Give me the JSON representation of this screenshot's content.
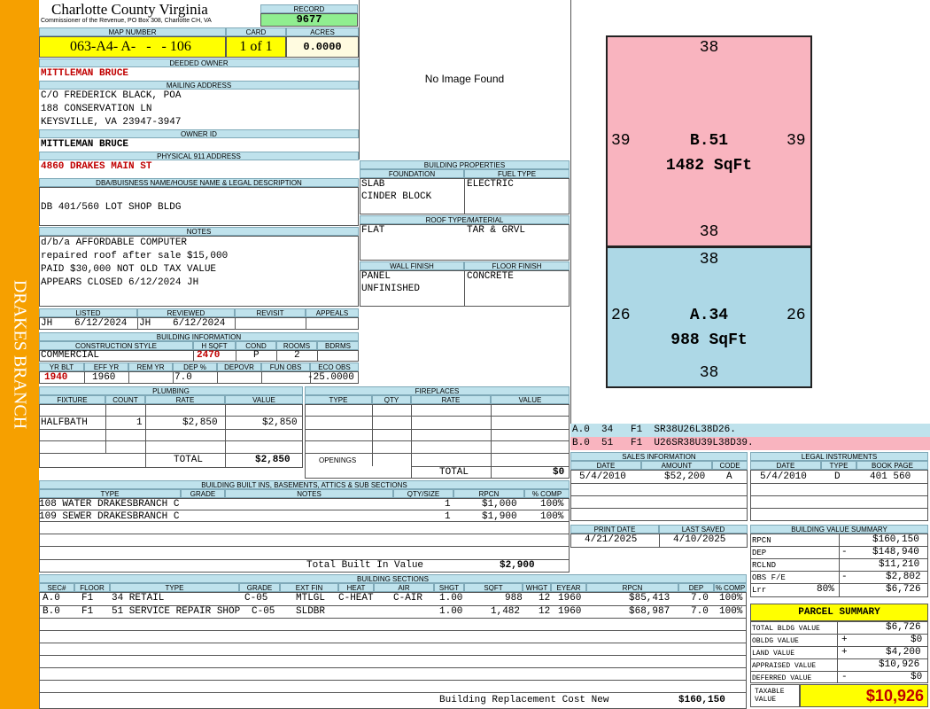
{
  "county_title": "Charlotte County Virginia",
  "county_sub": "Commissioner of the Revenue, PO Box 308, Charlotte CH, VA",
  "side_label": "DRAKES BRANCH",
  "record": {
    "label": "RECORD",
    "value": "9677"
  },
  "map": {
    "label": "MAP NUMBER",
    "value": "063-A4- A-   -   - 106"
  },
  "card": {
    "label": "CARD",
    "value": "1 of 1"
  },
  "acres": {
    "label": "ACRES",
    "value": "0.0000"
  },
  "deeded_owner": {
    "label": "DEEDED OWNER",
    "value": "MITTLEMAN BRUCE"
  },
  "mailing": {
    "label": "MAILING ADDRESS",
    "lines": [
      "C/O FREDERICK BLACK, POA",
      "188 CONSERVATION LN",
      "KEYSVILLE, VA 23947-3947"
    ]
  },
  "owner_id": {
    "label": "OWNER ID",
    "value": "MITTLEMAN BRUCE"
  },
  "physical": {
    "label": "PHYSICAL 911 ADDRESS",
    "value": "4860 DRAKES MAIN ST"
  },
  "dba": {
    "label": "DBA/BUISNESS NAME/HOUSE NAME & LEGAL DESCRIPTION",
    "value": "DB 401/560 LOT SHOP BLDG"
  },
  "notes": {
    "label": "NOTES",
    "lines": [
      "d/b/a AFFORDABLE COMPUTER",
      "repaired roof after sale $15,000",
      "PAID $30,000 NOT OLD TAX VALUE",
      "APPEARS CLOSED 6/12/2024 JH"
    ]
  },
  "listed": {
    "label": "LISTED",
    "initials": "JH",
    "date": "6/12/2024"
  },
  "reviewed": {
    "label": "REVIEWED",
    "initials": "JH",
    "date": "6/12/2024"
  },
  "revisit": {
    "label": "REVISIT"
  },
  "appeals": {
    "label": "APPEALS"
  },
  "image_placeholder": "No Image Found",
  "building_props": {
    "label": "BUILDING PROPERTIES",
    "foundation_label": "FOUNDATION",
    "foundation": [
      "SLAB",
      "CINDER BLOCK"
    ],
    "fuel_label": "FUEL TYPE",
    "fuel": "ELECTRIC",
    "roof_label": "ROOF TYPE/MATERIAL",
    "roof_type": "FLAT",
    "roof_material": "TAR & GRVL",
    "wall_label": "WALL FINISH",
    "wall": [
      "PANEL",
      "UNFINISHED"
    ],
    "floor_label": "FLOOR FINISH",
    "floor": "CONCRETE"
  },
  "building_info": {
    "label": "BUILDING INFORMATION",
    "h_style": "CONSTRUCTION STYLE",
    "h_sqft": "H SQFT",
    "h_cond": "COND",
    "h_rooms": "ROOMS",
    "h_bdrms": "BDRMS",
    "style": "COMMERCIAL",
    "sqft": "2470",
    "cond": "P",
    "rooms": "2",
    "bdrms": "",
    "h_yrblt": "YR BLT",
    "h_effyr": "EFF YR",
    "h_remyr": "REM YR",
    "h_dep": "DEP %",
    "h_depovr": "DEPOVR",
    "h_funobs": "FUN OBS",
    "h_ecoobs": "ECO OBS",
    "yrblt": "1940",
    "effyr": "1960",
    "remyr": "",
    "dep": "7.0",
    "depovr": "",
    "funobs": "",
    "ecoobs": "-25.0000"
  },
  "plumbing": {
    "label": "PLUMBING",
    "headers": [
      "FIXTURE",
      "COUNT",
      "RATE",
      "VALUE"
    ],
    "rows": [
      {
        "fixture": "HALFBATH",
        "count": "1",
        "rate": "$2,850",
        "value": "$2,850"
      }
    ],
    "total_label": "TOTAL",
    "total": "$2,850"
  },
  "fireplaces": {
    "label": "FIREPLACES",
    "headers": [
      "TYPE",
      "QTY",
      "RATE",
      "VALUE"
    ],
    "openings_label": "OPENINGS",
    "total_label": "TOTAL",
    "total": "$0"
  },
  "builtins": {
    "label": "BUILDING BUILT INS, BASEMENTS, ATTICS & SUB SECTIONS",
    "headers": [
      "TYPE",
      "GRADE",
      "NOTES",
      "QTY/SIZE",
      "RPCN",
      "% COMP"
    ],
    "rows": [
      {
        "type": "108 WATER DRAKESBRANCH C",
        "qty": "1",
        "rpcn": "$1,000",
        "comp": "100%"
      },
      {
        "type": "109 SEWER DRAKESBRANCH C",
        "qty": "1",
        "rpcn": "$1,900",
        "comp": "100%"
      }
    ],
    "total_label": "Total Built In Value",
    "total": "$2,900"
  },
  "sections": {
    "label": "BUILDING SECTIONS",
    "headers": [
      "SEC#",
      "FLOOR",
      "TYPE",
      "GRADE",
      "EXT FIN",
      "HEAT",
      "AIR",
      "SHGT",
      "SQFT",
      "WHGT",
      "EYEAR",
      "RPCN",
      "DEP",
      "% COMP"
    ],
    "rows": [
      {
        "sec": "A.0",
        "floor": "F1",
        "type": "34 RETAIL",
        "grade": "C-05",
        "extfin": "MTLGL",
        "heat": "C-HEAT",
        "air": "C-AIR",
        "shgt": "1.00",
        "sqft": "988",
        "whgt": "12",
        "eyear": "1960",
        "rpcn": "$85,413",
        "dep": "7.0",
        "comp": "100%"
      },
      {
        "sec": "B.0",
        "floor": "F1",
        "type": "51 SERVICE REPAIR SHOP",
        "grade": "C-05",
        "extfin": "SLDBR",
        "heat": "",
        "air": "",
        "shgt": "1.00",
        "sqft": "1,482",
        "whgt": "12",
        "eyear": "1960",
        "rpcn": "$68,987",
        "dep": "7.0",
        "comp": "100%"
      }
    ],
    "replacement_label": "Building Replacement Cost New",
    "replacement": "$160,150"
  },
  "sketch": {
    "b": {
      "top": "38",
      "left": "39",
      "right": "39",
      "bottom": "38",
      "name": "B.51",
      "area": "1482 SqFt",
      "color": "#f9b4bf"
    },
    "a": {
      "top": "38",
      "left": "26",
      "right": "26",
      "bottom": "38",
      "name": "A.34",
      "area": "988 SqFt",
      "color": "#add8e6"
    },
    "legend": [
      {
        "text": "A.0  34   F1  SR38U26L38D26.",
        "color": "#bfe2ec"
      },
      {
        "text": "B.0  51   F1  U26SR38U39L38D39.",
        "color": "#f9b4bf"
      }
    ]
  },
  "sales": {
    "label": "SALES INFORMATION",
    "headers": [
      "DATE",
      "AMOUNT",
      "CODE"
    ],
    "rows": [
      {
        "date": "5/4/2010",
        "amount": "$52,200",
        "code": "A"
      }
    ]
  },
  "legal": {
    "label": "LEGAL INSTRUMENTS",
    "headers": [
      "DATE",
      "TYPE",
      "BOOK PAGE"
    ],
    "rows": [
      {
        "date": "5/4/2010",
        "type": "D",
        "book": "401 560"
      }
    ]
  },
  "print_date": {
    "label": "PRINT DATE",
    "value": "4/21/2025"
  },
  "last_saved": {
    "label": "LAST SAVED",
    "value": "4/10/2025"
  },
  "bvs": {
    "label": "BUILDING VALUE SUMMARY",
    "rows": [
      {
        "name": "RPCN",
        "sign": "",
        "value": "$160,150"
      },
      {
        "name": "DEP",
        "sign": "-",
        "value": "$148,940"
      },
      {
        "name": "RCLND",
        "sign": "",
        "value": "$11,210"
      },
      {
        "name": "OBS F/E",
        "sign": "-",
        "value": "$2,802"
      },
      {
        "name": "Lrr",
        "pct": "80%",
        "sign": "",
        "value": "$6,726"
      }
    ]
  },
  "parcel": {
    "label": "PARCEL SUMMARY",
    "rows": [
      {
        "name": "TOTAL BLDG VALUE",
        "sign": "",
        "value": "$6,726"
      },
      {
        "name": "OBLDG VALUE",
        "sign": "+",
        "value": "$0"
      },
      {
        "name": "LAND VALUE",
        "sign": "+",
        "value": "$4,200"
      },
      {
        "name": "APPRAISED VALUE",
        "sign": "",
        "value": "$10,926"
      },
      {
        "name": "DEFERRED VALUE",
        "sign": "-",
        "value": "$0"
      }
    ],
    "taxable_label": "TAXABLE VALUE",
    "taxable": "$10,926"
  }
}
